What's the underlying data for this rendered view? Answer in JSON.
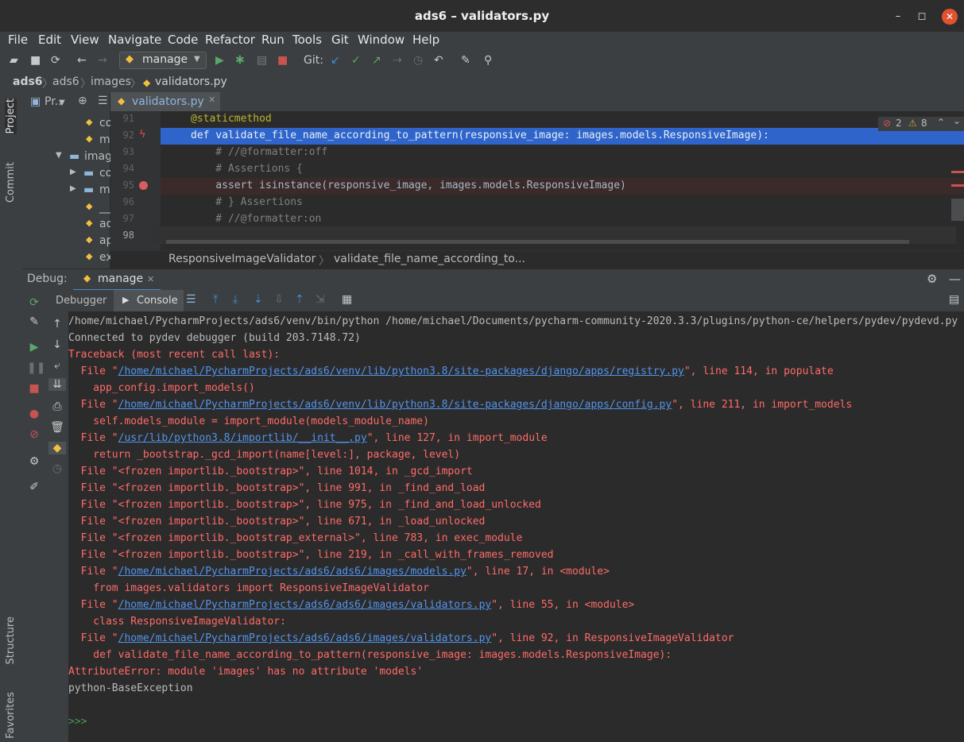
{
  "window": {
    "title": "ads6 – validators.py",
    "minimize": "–",
    "maximize": "◻",
    "close": "✕"
  },
  "menu": [
    "File",
    "Edit",
    "View",
    "Navigate",
    "Code",
    "Refactor",
    "Run",
    "Tools",
    "Git",
    "Window",
    "Help"
  ],
  "toolbar": {
    "run_config": "manage",
    "git_label": "Git:"
  },
  "breadcrumb": [
    "ads6",
    "ads6",
    "images",
    "validators.py"
  ],
  "sidebar_left": {
    "project": "Project",
    "commit": "Commit",
    "structure": "Structure",
    "favorites": "Favorites"
  },
  "project_panel": {
    "title": "Pr..",
    "items": [
      "co",
      "m",
      "imag",
      "co",
      "m",
      "__",
      "ad",
      "ap",
      "ex"
    ]
  },
  "editor": {
    "tab": "validators.py",
    "inspections": {
      "errors": "2",
      "warnings": "8"
    },
    "lines": [
      {
        "num": "91",
        "text": "@staticmethod"
      },
      {
        "num": "92",
        "text": "def validate_file_name_according_to_pattern(responsive_image: images.models.ResponsiveImage):"
      },
      {
        "num": "93",
        "text": "    # //@formatter:off"
      },
      {
        "num": "94",
        "text": "    # Assertions {"
      },
      {
        "num": "95",
        "text": "    assert isinstance(responsive_image, images.models.ResponsiveImage)"
      },
      {
        "num": "96",
        "text": "    # } Assertions"
      },
      {
        "num": "97",
        "text": "    # //@formatter:on"
      },
      {
        "num": "98",
        "text": ""
      }
    ],
    "status_crumbs": [
      "ResponsiveImageValidator",
      "validate_file_name_according_to..."
    ]
  },
  "debug": {
    "label": "Debug:",
    "session": "manage",
    "tabs": [
      "Debugger",
      "Console"
    ]
  },
  "console": {
    "lines": [
      {
        "t": "plain",
        "text": "/home/michael/PycharmProjects/ads6/venv/bin/python /home/michael/Documents/pycharm-community-2020.3.3/plugins/python-ce/helpers/pydev/pydevd.py"
      },
      {
        "t": "plain",
        "text": "Connected to pydev debugger (build 203.7148.72)"
      },
      {
        "t": "err",
        "text": "Traceback (most recent call last):"
      },
      {
        "t": "file",
        "pre": "  File \"",
        "link": "/home/michael/PycharmProjects/ads6/venv/lib/python3.8/site-packages/django/apps/registry.py",
        "post": "\", line 114, in populate"
      },
      {
        "t": "err",
        "text": "    app_config.import_models()"
      },
      {
        "t": "file",
        "pre": "  File \"",
        "link": "/home/michael/PycharmProjects/ads6/venv/lib/python3.8/site-packages/django/apps/config.py",
        "post": "\", line 211, in import_models"
      },
      {
        "t": "err",
        "text": "    self.models_module = import_module(models_module_name)"
      },
      {
        "t": "file",
        "pre": "  File \"",
        "link": "/usr/lib/python3.8/importlib/__init__.py",
        "post": "\", line 127, in import_module"
      },
      {
        "t": "err",
        "text": "    return _bootstrap._gcd_import(name[level:], package, level)"
      },
      {
        "t": "err",
        "text": "  File \"<frozen importlib._bootstrap>\", line 1014, in _gcd_import"
      },
      {
        "t": "err",
        "text": "  File \"<frozen importlib._bootstrap>\", line 991, in _find_and_load"
      },
      {
        "t": "err",
        "text": "  File \"<frozen importlib._bootstrap>\", line 975, in _find_and_load_unlocked"
      },
      {
        "t": "err",
        "text": "  File \"<frozen importlib._bootstrap>\", line 671, in _load_unlocked"
      },
      {
        "t": "err",
        "text": "  File \"<frozen importlib._bootstrap_external>\", line 783, in exec_module"
      },
      {
        "t": "err",
        "text": "  File \"<frozen importlib._bootstrap>\", line 219, in _call_with_frames_removed"
      },
      {
        "t": "file",
        "pre": "  File \"",
        "link": "/home/michael/PycharmProjects/ads6/ads6/images/models.py",
        "post": "\", line 17, in <module>"
      },
      {
        "t": "err",
        "text": "    from images.validators import ResponsiveImageValidator"
      },
      {
        "t": "file",
        "pre": "  File \"",
        "link": "/home/michael/PycharmProjects/ads6/ads6/images/validators.py",
        "post": "\", line 55, in <module>"
      },
      {
        "t": "err",
        "text": "    class ResponsiveImageValidator:"
      },
      {
        "t": "file",
        "pre": "  File \"",
        "link": "/home/michael/PycharmProjects/ads6/ads6/images/validators.py",
        "post": "\", line 92, in ResponsiveImageValidator"
      },
      {
        "t": "err",
        "text": "    def validate_file_name_according_to_pattern(responsive_image: images.models.ResponsiveImage):"
      },
      {
        "t": "err",
        "text": "AttributeError: module 'images' has no attribute 'models'"
      },
      {
        "t": "plain",
        "text": "python-BaseException"
      },
      {
        "t": "plain",
        "text": ""
      },
      {
        "t": "prompt",
        "text": ">>>"
      }
    ]
  },
  "colors": {
    "error": "#ff6b68",
    "link": "#5394ec",
    "selection": "#2f65ca",
    "prompt": "#499c54"
  }
}
